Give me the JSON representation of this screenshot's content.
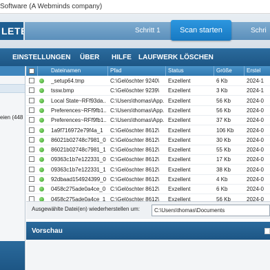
{
  "window": {
    "title": "Software (A Webminds company)"
  },
  "banner": {
    "logo_text": "LETE",
    "step1": "Schritt 1",
    "scan_button": "Scan starten",
    "step2": "Schri"
  },
  "menu": [
    "EINSTELLUNGEN",
    "ÜBER",
    "HILFE",
    "LAUFWERK LÖSCHEN"
  ],
  "left_panel": {
    "partial_text": "eien (448"
  },
  "table": {
    "columns": [
      "Dateinamen",
      "Pfad",
      "Status",
      "Größe",
      "Erstel"
    ],
    "rows": [
      [
        "_setup64.tmp",
        "C:\\Gelöschter 9240\\",
        "Exzellent",
        "6 Kb",
        "2024-1"
      ],
      [
        "tssw.bmp",
        "C:\\Gelöschter 9239\\",
        "Exzellent",
        "3 Kb",
        "2024-1"
      ],
      [
        "Local State~RFf93da...",
        "C:\\Users\\thomas\\App...",
        "Exzellent",
        "56 Kb",
        "2024-0"
      ],
      [
        "Preferences~RFf9fb1...",
        "C:\\Users\\thomas\\App...",
        "Exzellent",
        "56 Kb",
        "2024-0"
      ],
      [
        "Preferences~RFf9fb1...",
        "C:\\Users\\thomas\\App...",
        "Exzellent",
        "37 Kb",
        "2024-0"
      ],
      [
        "1a9f716972e79f4a_1",
        "C:\\Gelöschter 8612\\",
        "Exzellent",
        "106 Kb",
        "2024-0"
      ],
      [
        "86021b02748c7981_0",
        "C:\\Gelöschter 8612\\",
        "Exzellent",
        "30 Kb",
        "2024-0"
      ],
      [
        "86021b02748c7981_1",
        "C:\\Gelöschter 8612\\",
        "Exzellent",
        "55 Kb",
        "2024-0"
      ],
      [
        "09363c1b7e122331_0",
        "C:\\Gelöschter 8612\\",
        "Exzellent",
        "17 Kb",
        "2024-0"
      ],
      [
        "09363c1b7e122331_1",
        "C:\\Gelöschter 8612\\",
        "Exzellent",
        "38 Kb",
        "2024-0"
      ],
      [
        "92dbaad154924399_0",
        "C:\\Gelöschter 8612\\",
        "Exzellent",
        "4 Kb",
        "2024-0"
      ],
      [
        "0458c275ade0a4ce_0",
        "C:\\Gelöschter 8612\\",
        "Exzellent",
        "6 Kb",
        "2024-0"
      ],
      [
        "0458c275ade0a4ce_1",
        "C:\\Gelöschter 8612\\",
        "Exzellent",
        "56 Kb",
        "2024-0"
      ]
    ]
  },
  "restore": {
    "label": "Ausgewählte Datei(en) wiederherstellen um:",
    "path": "C:\\Users\\thomas\\Documents"
  },
  "preview": {
    "title": "Vorschau"
  },
  "colors": {
    "accent": "#1d5685",
    "scan_button": "#1779c2",
    "status_ok": "#3a9d2a"
  }
}
